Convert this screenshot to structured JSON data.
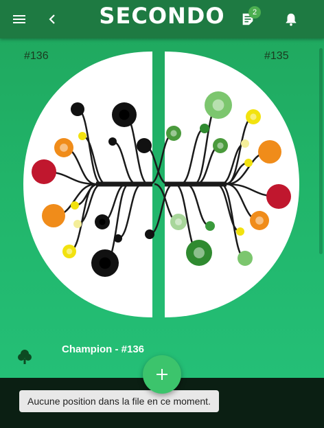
{
  "app": {
    "title": "SECONDO"
  },
  "header": {
    "notes_badge": "2"
  },
  "icons": {
    "menu": "menu-icon",
    "back": "chevron-left-icon",
    "notes": "note-icon",
    "bell": "bell-icon",
    "tree": "tree-icon",
    "add": "plus-icon"
  },
  "lineages": {
    "left_id": "#136",
    "right_id": "#135",
    "left_nodes": [
      {
        "color": "#111111",
        "kind": "dot"
      },
      {
        "color": "#111111",
        "kind": "ring"
      },
      {
        "color": "#f2e20f",
        "kind": "dot"
      },
      {
        "color": "#111111",
        "kind": "dot"
      },
      {
        "color": "#111111",
        "kind": "dot"
      },
      {
        "color": "#f08c1a",
        "kind": "ring"
      },
      {
        "color": "#c0172e",
        "kind": "dot"
      },
      {
        "color": "#f2e20f",
        "kind": "dot"
      },
      {
        "color": "#f08c1a",
        "kind": "dot"
      },
      {
        "color": "#f4ee9a",
        "kind": "dot"
      },
      {
        "color": "#111111",
        "kind": "ring"
      },
      {
        "color": "#111111",
        "kind": "dot"
      },
      {
        "color": "#111111",
        "kind": "dot"
      },
      {
        "color": "#f2e20f",
        "kind": "ring"
      },
      {
        "color": "#111111",
        "kind": "ring"
      }
    ],
    "right_nodes": [
      {
        "color": "#7cc66e",
        "kind": "ring"
      },
      {
        "color": "#f2e20f",
        "kind": "ring"
      },
      {
        "color": "#4a9a3c",
        "kind": "ring"
      },
      {
        "color": "#2f8a30",
        "kind": "dot"
      },
      {
        "color": "#4a9a3c",
        "kind": "ring"
      },
      {
        "color": "#f4ee9a",
        "kind": "dot"
      },
      {
        "color": "#f2e20f",
        "kind": "dot"
      },
      {
        "color": "#f08c1a",
        "kind": "dot"
      },
      {
        "color": "#c0172e",
        "kind": "dot"
      },
      {
        "color": "#f08c1a",
        "kind": "ring"
      },
      {
        "color": "#a8d69a",
        "kind": "ring"
      },
      {
        "color": "#3a9a3c",
        "kind": "dot"
      },
      {
        "color": "#f2e20f",
        "kind": "dot"
      },
      {
        "color": "#2f8a30",
        "kind": "ring"
      },
      {
        "color": "#7cc66e",
        "kind": "dot"
      }
    ]
  },
  "champion": {
    "label": "Champion - #136"
  },
  "queue": {
    "message": "Aucune position dans la file en ce moment."
  },
  "colors": {
    "appbar": "#1e7a42",
    "background": "#21b56a",
    "fab": "#3cc46c",
    "bottom": "#0b1f13",
    "branch": "#1a1a1a"
  }
}
